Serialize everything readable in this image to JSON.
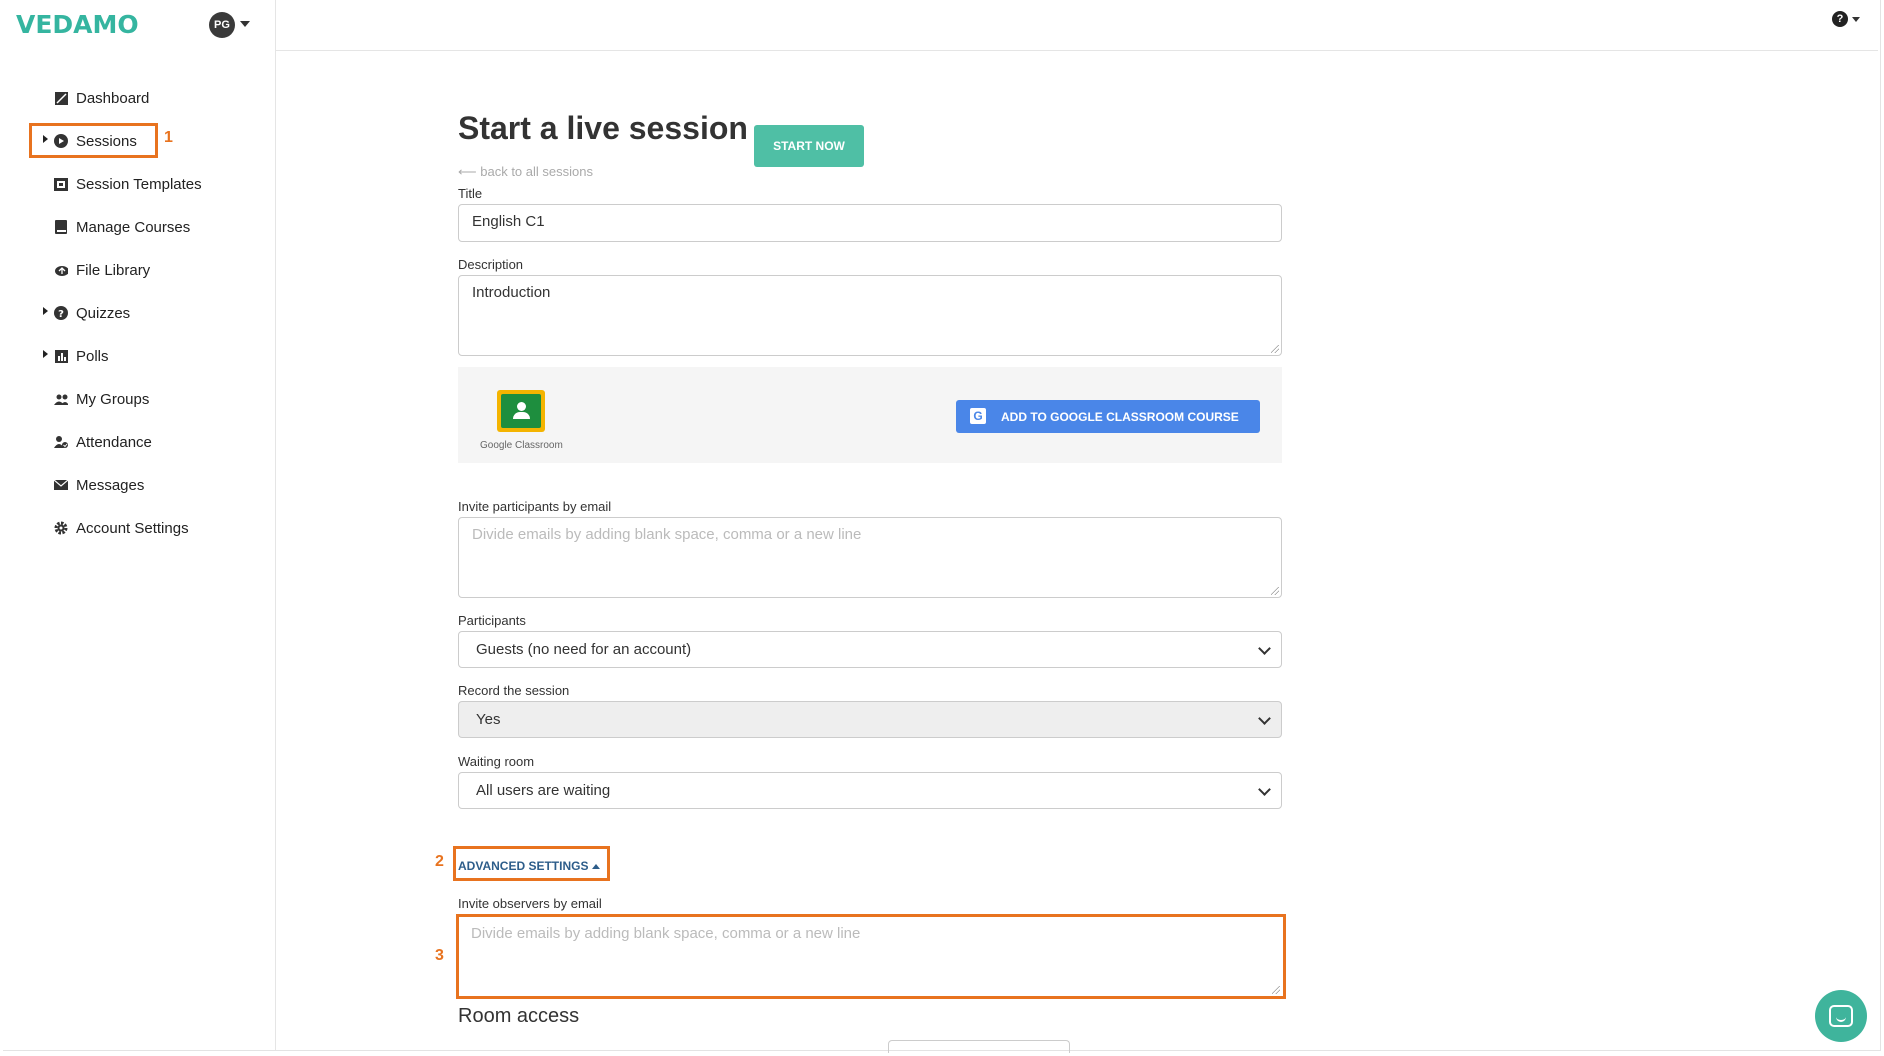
{
  "brand": {
    "logo_text": "VEDAMO",
    "color": "#35b5a0"
  },
  "user": {
    "initials": "PG"
  },
  "header": {
    "help_icon": "help-circle-icon"
  },
  "sidebar": {
    "items": [
      {
        "label": "Dashboard",
        "icon": "dashboard-icon",
        "has_caret": false
      },
      {
        "label": "Sessions",
        "icon": "play-circle-icon",
        "has_caret": true
      },
      {
        "label": "Session Templates",
        "icon": "templates-icon",
        "has_caret": false
      },
      {
        "label": "Manage Courses",
        "icon": "book-icon",
        "has_caret": false
      },
      {
        "label": "File Library",
        "icon": "cloud-icon",
        "has_caret": false
      },
      {
        "label": "Quizzes",
        "icon": "question-icon",
        "has_caret": true
      },
      {
        "label": "Polls",
        "icon": "bar-chart-icon",
        "has_caret": true
      },
      {
        "label": "My Groups",
        "icon": "group-icon",
        "has_caret": false
      },
      {
        "label": "Attendance",
        "icon": "attendance-icon",
        "has_caret": false
      },
      {
        "label": "Messages",
        "icon": "envelope-icon",
        "has_caret": false
      },
      {
        "label": "Account Settings",
        "icon": "gear-icon",
        "has_caret": false
      }
    ]
  },
  "annotations": {
    "one": "1",
    "two": "2",
    "three": "3",
    "color": "#e8731f"
  },
  "main": {
    "title": "Start a live session",
    "start_button": "START NOW",
    "back_link": "⟵ back to all sessions",
    "title_label": "Title",
    "title_value": "English C1",
    "description_label": "Description",
    "description_value": "Introduction",
    "google_classroom_text": "Google Classroom",
    "google_button": "ADD TO GOOGLE CLASSROOM COURSE",
    "invite_label": "Invite participants by email",
    "invite_placeholder": "Divide emails by adding blank space, comma or a new line",
    "participants_label": "Participants",
    "participants_value": "Guests (no need for an account)",
    "record_label": "Record the session",
    "record_value": "Yes",
    "waiting_label": "Waiting room",
    "waiting_value": "All users are waiting",
    "advanced_settings": "ADVANCED SETTINGS",
    "observers_label": "Invite observers by email",
    "observers_placeholder": "Divide emails by adding blank space, comma or a new line",
    "room_access": "Room access"
  }
}
